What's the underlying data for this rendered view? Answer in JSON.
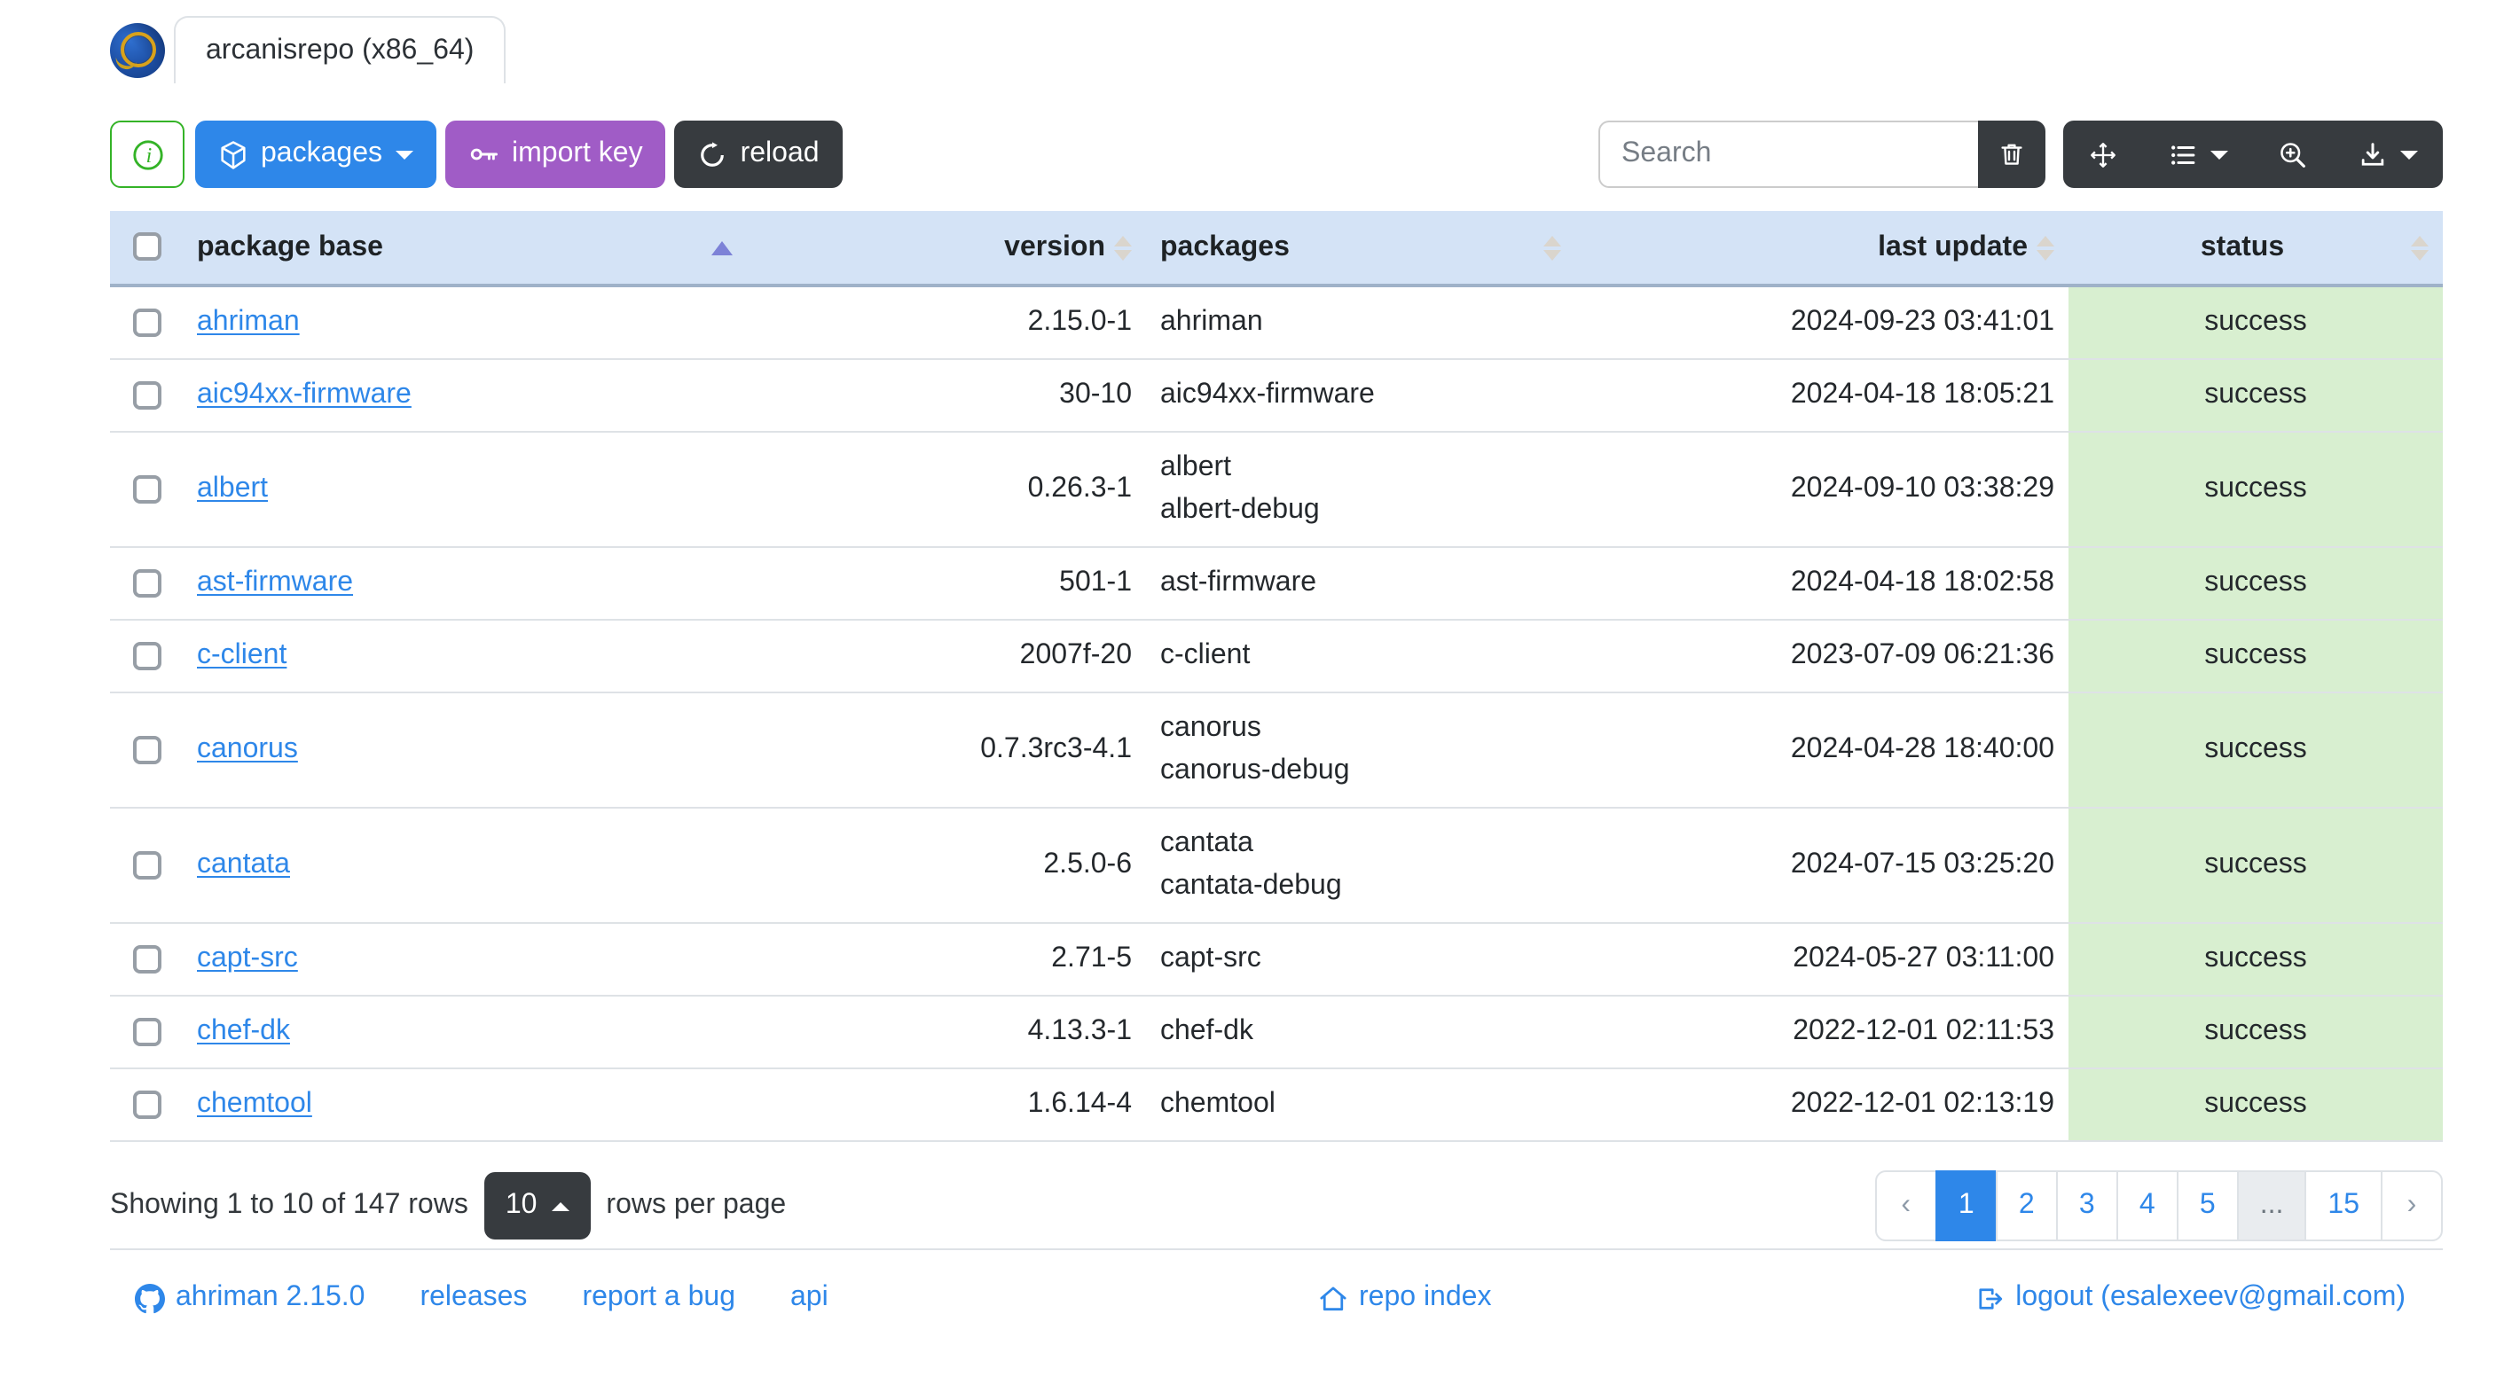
{
  "header": {
    "tab_title": "arcanisrepo (x86_64)",
    "logo": "ahriman-dragon-logo"
  },
  "toolbar": {
    "info_button": {
      "icon": "info-circle-icon"
    },
    "packages_button": {
      "label": "packages",
      "icon": "package-box-icon",
      "has_caret": true
    },
    "import_key_button": {
      "label": "import key",
      "icon": "key-icon"
    },
    "reload_button": {
      "label": "reload",
      "icon": "reload-icon"
    },
    "search": {
      "placeholder": "Search"
    },
    "clear_search_button": {
      "icon": "trash-icon"
    },
    "view_buttons": [
      {
        "icon": "fullscreen-move-icon"
      },
      {
        "icon": "columns-list-icon",
        "has_caret": true
      },
      {
        "icon": "zoom-in-icon"
      },
      {
        "icon": "export-download-icon",
        "has_caret": true
      }
    ]
  },
  "table": {
    "columns": [
      {
        "label": "",
        "type": "checkbox"
      },
      {
        "label": "package base",
        "align": "left",
        "sort": "asc"
      },
      {
        "label": "version",
        "align": "right",
        "sort": "none"
      },
      {
        "label": "packages",
        "align": "left",
        "sort": "none"
      },
      {
        "label": "last update",
        "align": "right",
        "sort": "none"
      },
      {
        "label": "status",
        "align": "center",
        "sort": "none"
      }
    ],
    "rows": [
      {
        "package_base": "ahriman",
        "version": "2.15.0-1",
        "packages": "ahriman",
        "last_update": "2024-09-23 03:41:01",
        "status": "success"
      },
      {
        "package_base": "aic94xx-firmware",
        "version": "30-10",
        "packages": "aic94xx-firmware",
        "last_update": "2024-04-18 18:05:21",
        "status": "success"
      },
      {
        "package_base": "albert",
        "version": "0.26.3-1",
        "packages": "albert\nalbert-debug",
        "last_update": "2024-09-10 03:38:29",
        "status": "success"
      },
      {
        "package_base": "ast-firmware",
        "version": "501-1",
        "packages": "ast-firmware",
        "last_update": "2024-04-18 18:02:58",
        "status": "success"
      },
      {
        "package_base": "c-client",
        "version": "2007f-20",
        "packages": "c-client",
        "last_update": "2023-07-09 06:21:36",
        "status": "success"
      },
      {
        "package_base": "canorus",
        "version": "0.7.3rc3-4.1",
        "packages": "canorus\ncanorus-debug",
        "last_update": "2024-04-28 18:40:00",
        "status": "success"
      },
      {
        "package_base": "cantata",
        "version": "2.5.0-6",
        "packages": "cantata\ncantata-debug",
        "last_update": "2024-07-15 03:25:20",
        "status": "success"
      },
      {
        "package_base": "capt-src",
        "version": "2.71-5",
        "packages": "capt-src",
        "last_update": "2024-05-27 03:11:00",
        "status": "success"
      },
      {
        "package_base": "chef-dk",
        "version": "4.13.3-1",
        "packages": "chef-dk",
        "last_update": "2022-12-01 02:11:53",
        "status": "success"
      },
      {
        "package_base": "chemtool",
        "version": "1.6.14-4",
        "packages": "chemtool",
        "last_update": "2022-12-01 02:13:19",
        "status": "success"
      }
    ]
  },
  "pagination": {
    "summary": "Showing 1 to 10 of 147 rows",
    "page_size": "10",
    "rows_per_page_label": "rows per page",
    "prev_label": "‹",
    "next_label": "›",
    "pages": [
      "1",
      "2",
      "3",
      "4",
      "5",
      "...",
      "15"
    ],
    "active_page": "1"
  },
  "footer": {
    "app_link": "ahriman 2.15.0",
    "releases_link": "releases",
    "bug_link": "report a bug",
    "api_link": "api",
    "repo_index_link": "repo index",
    "logout_link": "logout (esalexeev@gmail.com)"
  },
  "colors": {
    "primary_blue": "#2e87e9",
    "purple": "#a05cc6",
    "success_green": "#34b327",
    "dark": "#373b3f",
    "table_header_bg": "#d4e3f6",
    "status_cell_bg": "#d8efd0",
    "border": "#dee2e6",
    "sort_active_arrow": "#7d82d7"
  }
}
